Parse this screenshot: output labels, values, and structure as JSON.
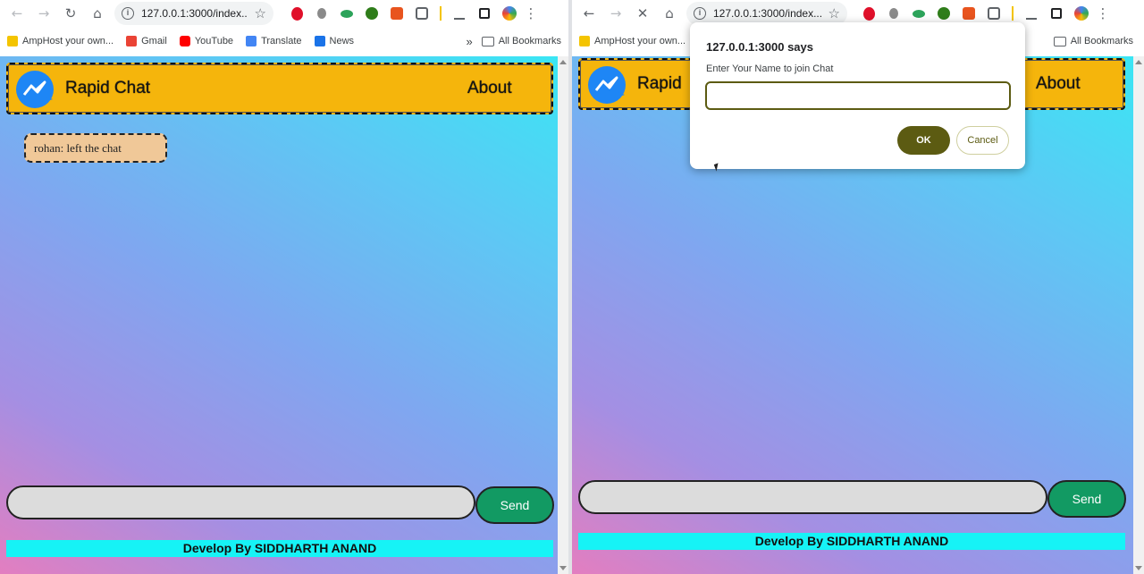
{
  "left": {
    "url": "127.0.0.1:3000/index...",
    "bookmarks": [
      {
        "label": "AmpHost your own...",
        "color": "#f4c400"
      },
      {
        "label": "Gmail",
        "color": "#ea4335"
      },
      {
        "label": "YouTube",
        "color": "#ff0000"
      },
      {
        "label": "Translate",
        "color": "#4285f4"
      },
      {
        "label": "News",
        "color": "#1a73e8"
      }
    ],
    "all_bookmarks": "All Bookmarks",
    "brand": "Rapid Chat",
    "about": "About",
    "messages": [
      "rohan: left the chat"
    ],
    "send_label": "Send",
    "footer": "Develop By SIDDHARTH ANAND"
  },
  "right": {
    "url": "127.0.0.1:3000/index...",
    "bookmarks": [
      {
        "label": "AmpHost your own...",
        "color": "#f4c400"
      }
    ],
    "all_bookmarks": "All Bookmarks",
    "brand": "Rapid",
    "about": "About",
    "send_label": "Send",
    "footer": "Develop By SIDDHARTH ANAND",
    "dialog": {
      "title": "127.0.0.1:3000 says",
      "message": "Enter Your Name to join Chat",
      "input_value": "",
      "ok_label": "OK",
      "cancel_label": "Cancel"
    }
  },
  "icons": {
    "back": "←",
    "forward": "→",
    "reload": "↻",
    "stop": "✕",
    "home": "⌂",
    "star": "☆",
    "more": "»"
  },
  "colors": {
    "navbar": "#f5b50c",
    "send_button": "#129a63",
    "footer": "#16f3f6",
    "message_bubble": "#f0c898",
    "dialog_accent": "#5c5b12"
  }
}
